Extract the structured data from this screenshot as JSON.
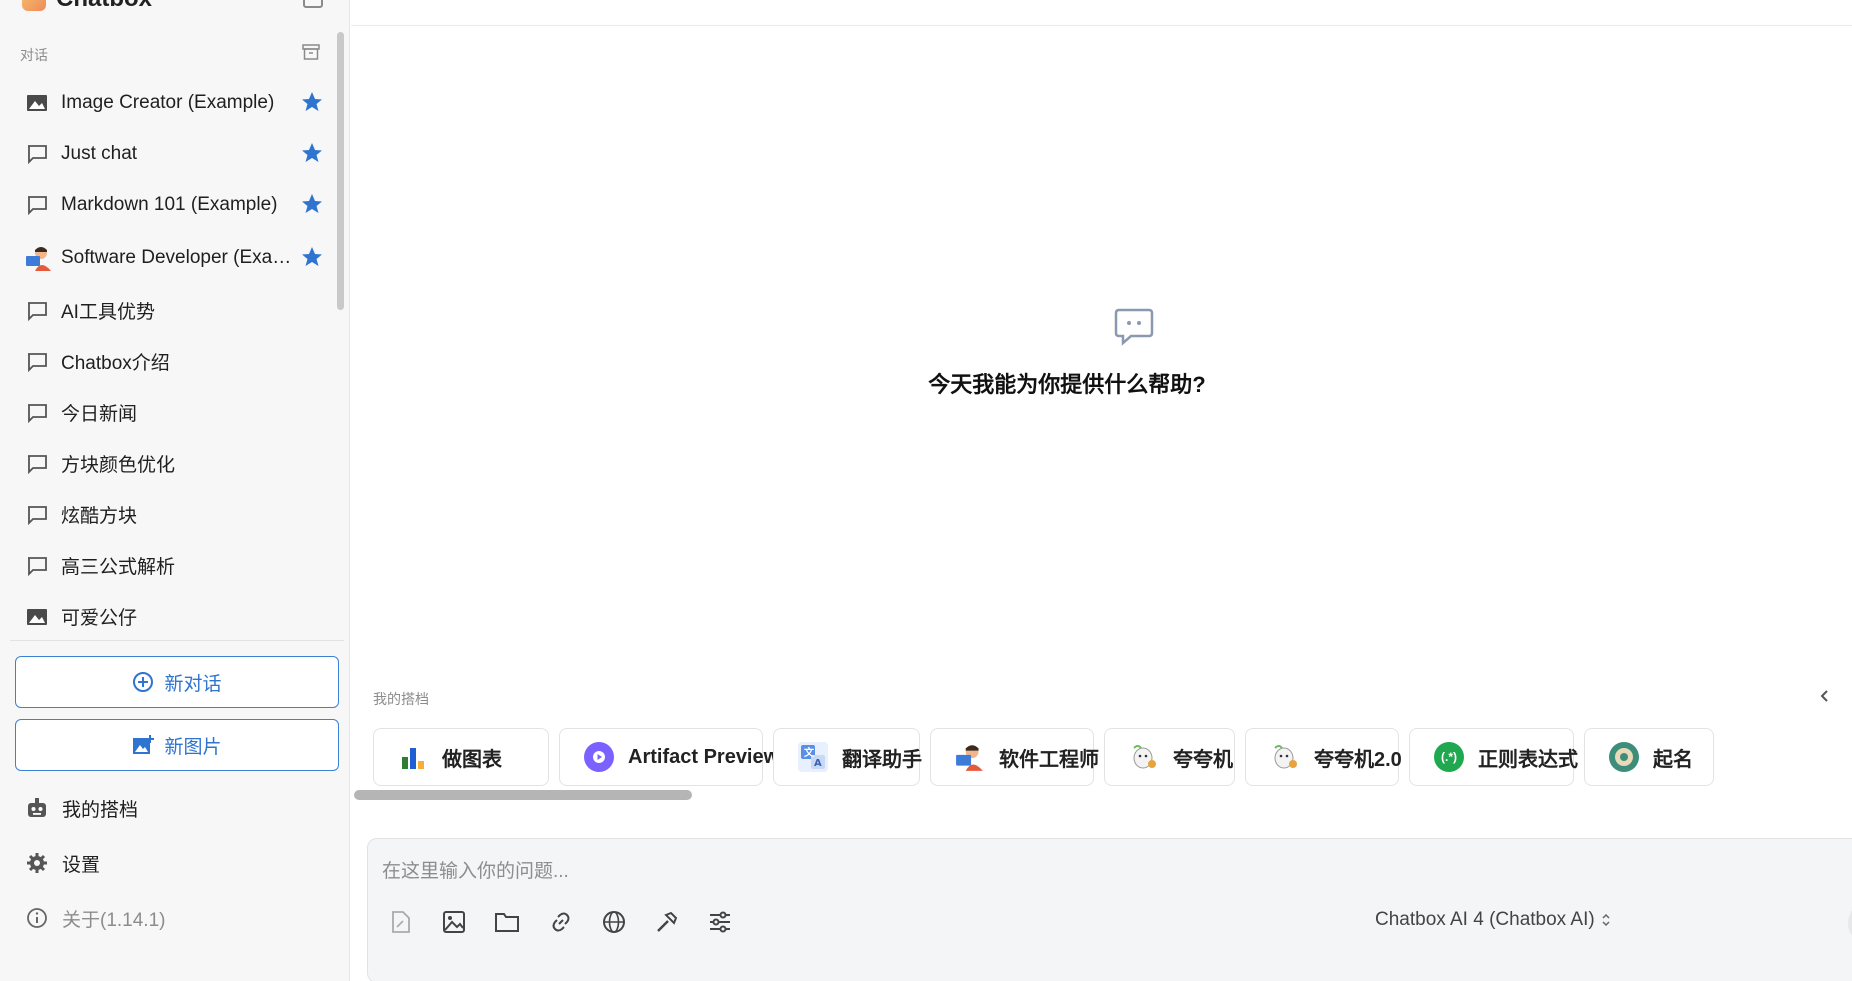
{
  "app": {
    "name": "Chatbox"
  },
  "sidebar": {
    "section_label": "对话",
    "sessions": [
      {
        "label": "Image Creator (Example)",
        "icon": "image-icon",
        "starred": true
      },
      {
        "label": "Just chat",
        "icon": "chat-bubble-icon",
        "starred": true
      },
      {
        "label": "Markdown 101 (Example)",
        "icon": "chat-bubble-icon",
        "starred": true
      },
      {
        "label": "Software Developer (Example)",
        "icon": "developer-avatar-icon",
        "starred": true
      },
      {
        "label": "AI工具优势",
        "icon": "chat-bubble-icon",
        "starred": false
      },
      {
        "label": "Chatbox介绍",
        "icon": "chat-bubble-icon",
        "starred": false
      },
      {
        "label": "今日新闻",
        "icon": "chat-bubble-icon",
        "starred": false
      },
      {
        "label": "方块颜色优化",
        "icon": "chat-bubble-icon",
        "starred": false
      },
      {
        "label": "炫酷方块",
        "icon": "chat-bubble-icon",
        "starred": false
      },
      {
        "label": "高三公式解析",
        "icon": "chat-bubble-icon",
        "starred": false
      },
      {
        "label": "可爱公仔",
        "icon": "image-icon",
        "starred": false
      }
    ],
    "new_chat_label": "新对话",
    "new_image_label": "新图片",
    "nav": {
      "partners_label": "我的搭档",
      "settings_label": "设置",
      "about_label": "关于(1.14.1)"
    }
  },
  "main": {
    "empty_title": "今天我能为你提供什么帮助?",
    "partners_label": "我的搭档",
    "partners": [
      {
        "label": "做图表",
        "icon": "bar-chart-icon",
        "color": "#2e7d32"
      },
      {
        "label": "Artifact Preview",
        "icon": "play-circle-icon",
        "color": "#7b61ff"
      },
      {
        "label": "翻译助手",
        "icon": "translate-icon",
        "color": "#5b8fe6"
      },
      {
        "label": "软件工程师",
        "icon": "developer-avatar-icon",
        "color": "#e65a3c"
      },
      {
        "label": "夸夸机",
        "icon": "cheer-bot-icon",
        "color": "#e8a33a"
      },
      {
        "label": "夸夸机2.0",
        "icon": "cheer-bot-icon",
        "color": "#e8a33a"
      },
      {
        "label": "正则表达式",
        "icon": "regex-icon",
        "color": "#1fa84f"
      },
      {
        "label": "起名",
        "icon": "compass-icon",
        "color": "#3c8d7a"
      }
    ],
    "composer": {
      "placeholder": "在这里输入你的问题...",
      "model_label": "Chatbox AI 4 (Chatbox AI)"
    }
  },
  "colors": {
    "accent": "#2f74cf",
    "star": "#2f74cf"
  }
}
